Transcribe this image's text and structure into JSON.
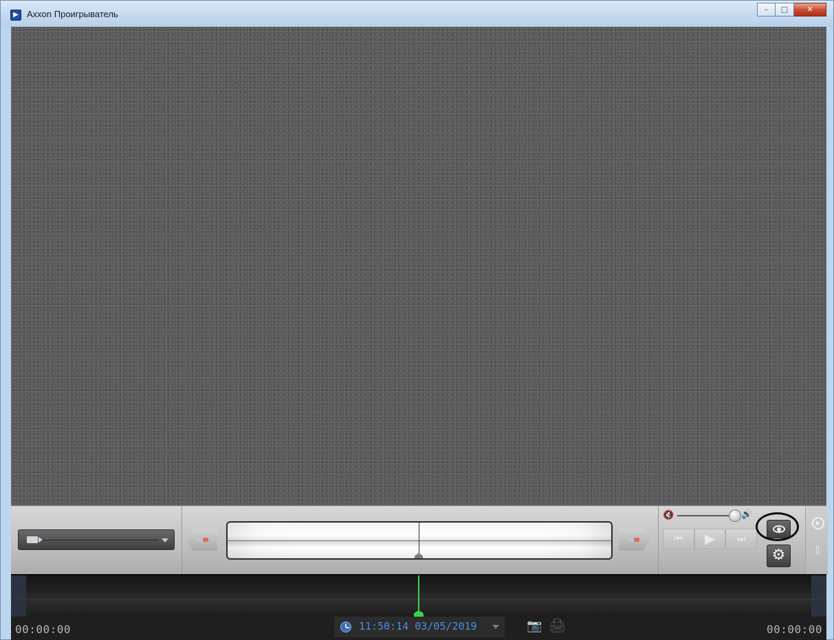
{
  "window": {
    "title": "Axxon Проигрыватель",
    "controls": {
      "minimize": "–",
      "maximize": "□",
      "close": "✕"
    }
  },
  "player": {
    "icons": [
      "camera-icon",
      "mute-icon",
      "volume-icon",
      "prev-icon",
      "play-icon",
      "next-icon",
      "eye-icon",
      "gear-icon",
      "snapshot-icon",
      "print-icon",
      "export-icon",
      "clock-icon"
    ],
    "time_start": "00:00:00",
    "time_end": "00:00:00",
    "datetime": "11:50:14 03/05/2019"
  },
  "colors": {
    "accent_blue": "#4d8fe0",
    "timeline_cursor": "#38d64a",
    "highlight_ring": "#0d0d0d"
  }
}
